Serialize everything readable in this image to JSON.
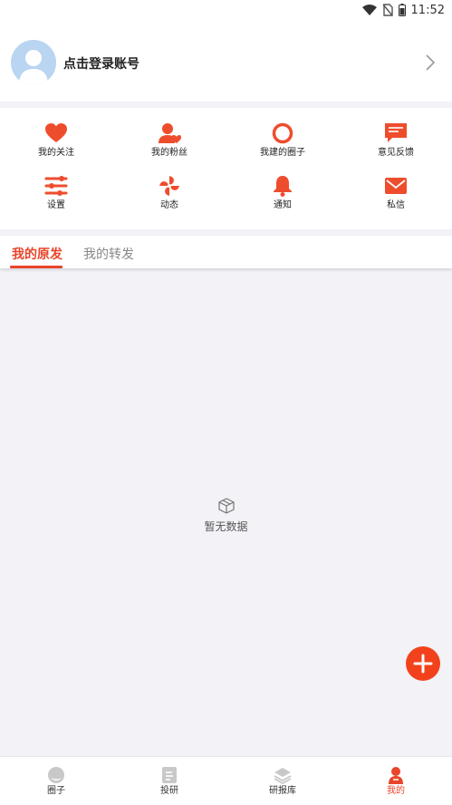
{
  "status_bar": {
    "time": "11:52"
  },
  "profile": {
    "login_prompt": "点击登录账号"
  },
  "menu": {
    "items": [
      {
        "label": "我的关注",
        "icon": "heart-icon"
      },
      {
        "label": "我的粉丝",
        "icon": "fans-icon"
      },
      {
        "label": "我建的圈子",
        "icon": "circle-icon"
      },
      {
        "label": "意见反馈",
        "icon": "feedback-icon"
      },
      {
        "label": "设置",
        "icon": "settings-sliders-icon"
      },
      {
        "label": "动态",
        "icon": "pinwheel-icon"
      },
      {
        "label": "通知",
        "icon": "bell-icon"
      },
      {
        "label": "私信",
        "icon": "mail-icon"
      }
    ]
  },
  "tabs": {
    "original": "我的原发",
    "forward": "我的转发"
  },
  "empty_state": {
    "text": "暂无数据"
  },
  "bottom_nav": {
    "items": [
      {
        "label": "圈子",
        "icon": "circle-nav-icon"
      },
      {
        "label": "投研",
        "icon": "document-icon"
      },
      {
        "label": "研报库",
        "icon": "layers-icon"
      },
      {
        "label": "我的",
        "icon": "user-icon"
      }
    ]
  },
  "colors": {
    "accent": "#e8452a",
    "fab": "#f2421b",
    "background": "#f2f2f7"
  }
}
